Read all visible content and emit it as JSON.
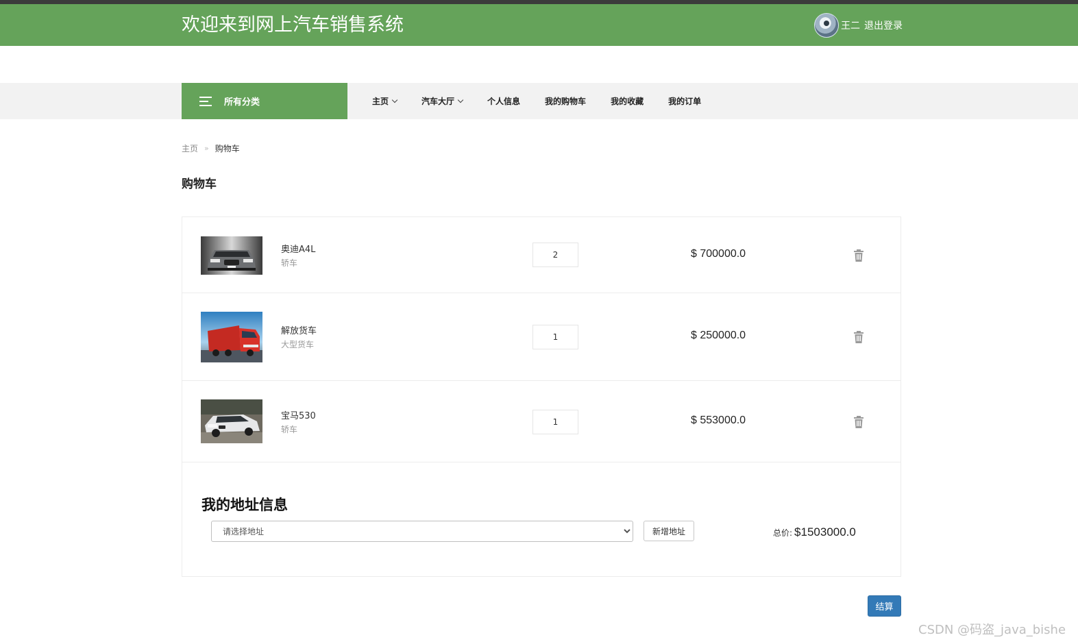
{
  "header": {
    "title": "欢迎来到网上汽车销售系统",
    "user_name": "王二",
    "logout_label": "退出登录",
    "brand_color": "#65a35a"
  },
  "nav": {
    "category_label": "所有分类",
    "items": [
      {
        "label": "主页",
        "has_dropdown": true
      },
      {
        "label": "汽车大厅",
        "has_dropdown": true
      },
      {
        "label": "个人信息",
        "has_dropdown": false
      },
      {
        "label": "我的购物车",
        "has_dropdown": false
      },
      {
        "label": "我的收藏",
        "has_dropdown": false
      },
      {
        "label": "我的订单",
        "has_dropdown": false
      }
    ]
  },
  "breadcrumb": {
    "home": "主页",
    "separator": "»",
    "current": "购物车"
  },
  "page_title": "购物车",
  "cart": {
    "items": [
      {
        "name": "奥迪A4L",
        "category": "轿车",
        "quantity": "2",
        "price": "$ 700000.0",
        "image": "silver-sedan-front"
      },
      {
        "name": "解放货车",
        "category": "大型货车",
        "quantity": "1",
        "price": "$ 250000.0",
        "image": "red-truck"
      },
      {
        "name": "宝马530",
        "category": "轿车",
        "quantity": "1",
        "price": "$ 553000.0",
        "image": "white-sedan"
      }
    ],
    "delete_icon": "trash-icon"
  },
  "address": {
    "title": "我的地址信息",
    "select_placeholder": "请选择地址",
    "add_label": "新增地址"
  },
  "total": {
    "label": "总价:",
    "value": "$1503000.0"
  },
  "checkout_label": "结算",
  "checkout_color": "#337ab7",
  "watermark": "CSDN @码盗_java_bishe"
}
